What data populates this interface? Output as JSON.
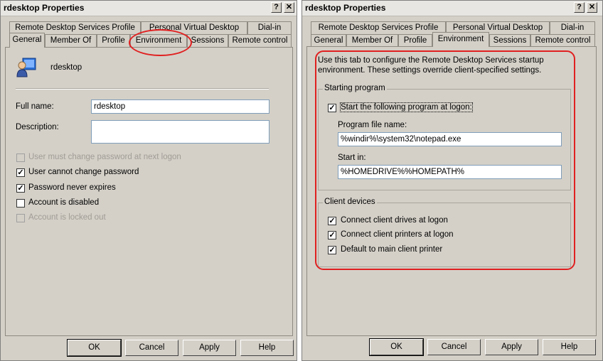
{
  "left": {
    "title": "rdesktop Properties",
    "help_btn": "?",
    "close_btn": "✕",
    "tabs_row1": [
      "Remote Desktop Services Profile",
      "Personal Virtual Desktop",
      "Dial-in"
    ],
    "tabs_row2": [
      "General",
      "Member Of",
      "Profile",
      "Environment",
      "Sessions",
      "Remote control"
    ],
    "username": "rdesktop",
    "full_name_label": "Full name:",
    "full_name_value": "rdesktop",
    "description_label": "Description:",
    "description_value": "",
    "checkboxes": [
      {
        "label": "User must change password at next logon",
        "checked": false,
        "disabled": true
      },
      {
        "label": "User cannot change password",
        "checked": true,
        "disabled": false
      },
      {
        "label": "Password never expires",
        "checked": true,
        "disabled": false
      },
      {
        "label": "Account is disabled",
        "checked": false,
        "disabled": false
      },
      {
        "label": "Account is locked out",
        "checked": false,
        "disabled": true
      }
    ],
    "buttons": [
      "OK",
      "Cancel",
      "Apply",
      "Help"
    ]
  },
  "right": {
    "title": "rdesktop Properties",
    "help_btn": "?",
    "close_btn": "✕",
    "tabs_row1": [
      "Remote Desktop Services Profile",
      "Personal Virtual Desktop",
      "Dial-in"
    ],
    "tabs_row2": [
      "General",
      "Member Of",
      "Profile",
      "Environment",
      "Sessions",
      "Remote control"
    ],
    "intro_line1": "Use this tab to configure the Remote Desktop Services startup",
    "intro_line2": "environment. These settings override client-specified settings.",
    "starting_program": {
      "group_title": "Starting program",
      "checkbox_label": "Start the following program at logon:",
      "checked": true,
      "program_label": "Program file name:",
      "program_value": "%windir%\\system32\\notepad.exe",
      "start_in_label": "Start in:",
      "start_in_value": "%HOMEDRIVE%%HOMEPATH%"
    },
    "client_devices": {
      "group_title": "Client devices",
      "items": [
        {
          "label": "Connect client drives at logon",
          "checked": true
        },
        {
          "label": "Connect client printers at logon",
          "checked": true
        },
        {
          "label": "Default to main client printer",
          "checked": true
        }
      ]
    },
    "buttons": [
      "OK",
      "Cancel",
      "Apply",
      "Help"
    ]
  },
  "colors": {
    "highlight": "#e02020",
    "dialog_bg": "#d4d0c8"
  }
}
